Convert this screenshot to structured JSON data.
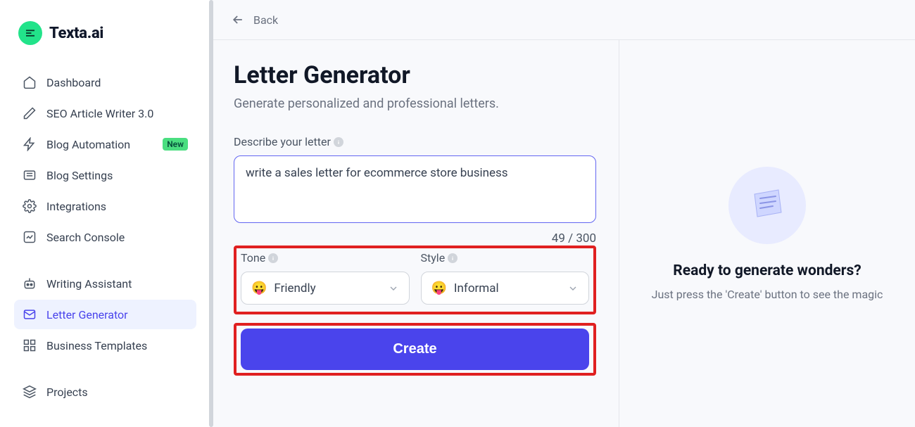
{
  "brand": {
    "name": "Texta.ai"
  },
  "sidebar": {
    "items": [
      {
        "label": "Dashboard",
        "icon": "home"
      },
      {
        "label": "SEO Article Writer 3.0",
        "icon": "pencil"
      },
      {
        "label": "Blog Automation",
        "icon": "bolt",
        "badge": "New"
      },
      {
        "label": "Blog Settings",
        "icon": "lines"
      },
      {
        "label": "Integrations",
        "icon": "gear"
      },
      {
        "label": "Search Console",
        "icon": "chart"
      }
    ],
    "items2": [
      {
        "label": "Writing Assistant",
        "icon": "bot"
      },
      {
        "label": "Letter Generator",
        "icon": "mail",
        "active": true
      },
      {
        "label": "Business Templates",
        "icon": "grid"
      }
    ],
    "items3": [
      {
        "label": "Projects",
        "icon": "layers"
      }
    ]
  },
  "topbar": {
    "back": "Back"
  },
  "page": {
    "title": "Letter Generator",
    "subtitle": "Generate personalized and professional letters."
  },
  "form": {
    "describe_label": "Describe your letter",
    "describe_value": "write a sales letter for ecommerce store business",
    "char_counter": "49 / 300",
    "tone_label": "Tone",
    "tone_value": "Friendly",
    "style_label": "Style",
    "style_value": "Informal",
    "create_label": "Create"
  },
  "preview": {
    "title": "Ready to generate wonders?",
    "subtitle": "Just press the 'Create' button to see the magic"
  }
}
